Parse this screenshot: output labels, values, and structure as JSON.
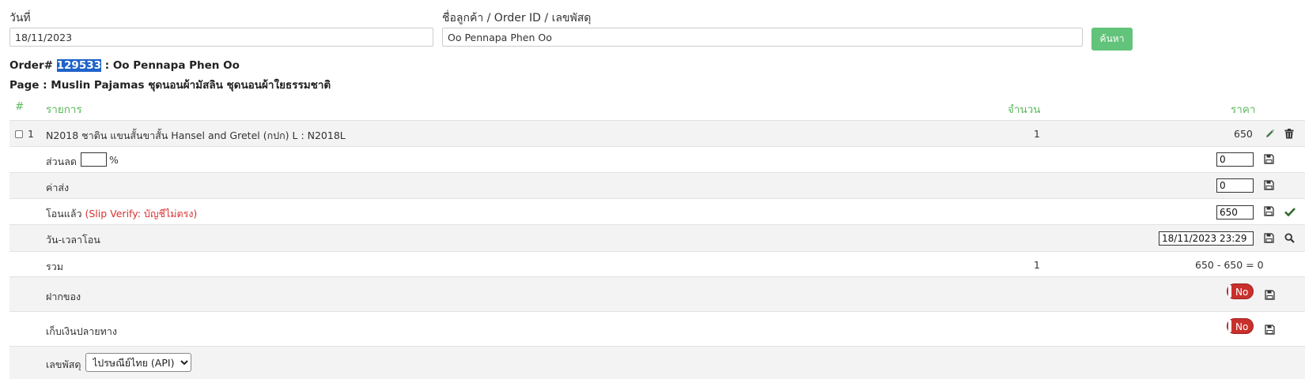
{
  "search": {
    "date_label": "วันที่",
    "date_value": "18/11/2023",
    "customer_label": "ชื่อลูกค้า / Order ID / เลขพัสดุ",
    "customer_value": "Oo Pennapa Phen Oo",
    "search_button": "ค้นหา"
  },
  "order": {
    "prefix": "Order#",
    "id": "129533",
    "customer_suffix": ": Oo Pennapa Phen Oo",
    "page_line": "Page : Muslin Pajamas ชุดนอนผ้ามัสลิน ชุดนอนผ้าใยธรรมชาติ"
  },
  "table": {
    "headers": {
      "num": "#",
      "item": "รายการ",
      "qty": "จำนวน",
      "price": "ราคา"
    },
    "item_row": {
      "index": "1",
      "name": "N2018 ชาติน แขนสั้นขาสั้น Hansel and Gretel (กปก) L : N2018L",
      "qty": "1",
      "price": "650"
    },
    "discount": {
      "label": "ส่วนลด",
      "percent_value": "",
      "unit": "%",
      "value": "0"
    },
    "shipping": {
      "label": "ค่าส่ง",
      "value": "0"
    },
    "transferred": {
      "label": "โอนแล้ว",
      "note": "(Slip Verify: บัญชีไม่ตรง)",
      "value": "650"
    },
    "transfer_time": {
      "label": "วัน-เวลาโอน",
      "value": "18/11/2023 23:29"
    },
    "total": {
      "label": "รวม",
      "qty": "1",
      "formula": "650 - 650 = 0"
    },
    "deposit": {
      "label": "ฝากของ",
      "toggle": "No"
    },
    "cod": {
      "label": "เก็บเงินปลายทาง",
      "toggle": "No"
    },
    "tracking": {
      "label": "เลขพัสดุ",
      "selected": "ไปรษณีย์ไทย (API)"
    }
  },
  "colors": {
    "accent_green": "#5cb85c",
    "button_green": "#62c37a",
    "toggle_red": "#c9302c",
    "highlight_blue": "#1f63c9",
    "error_red": "#d9302f"
  }
}
